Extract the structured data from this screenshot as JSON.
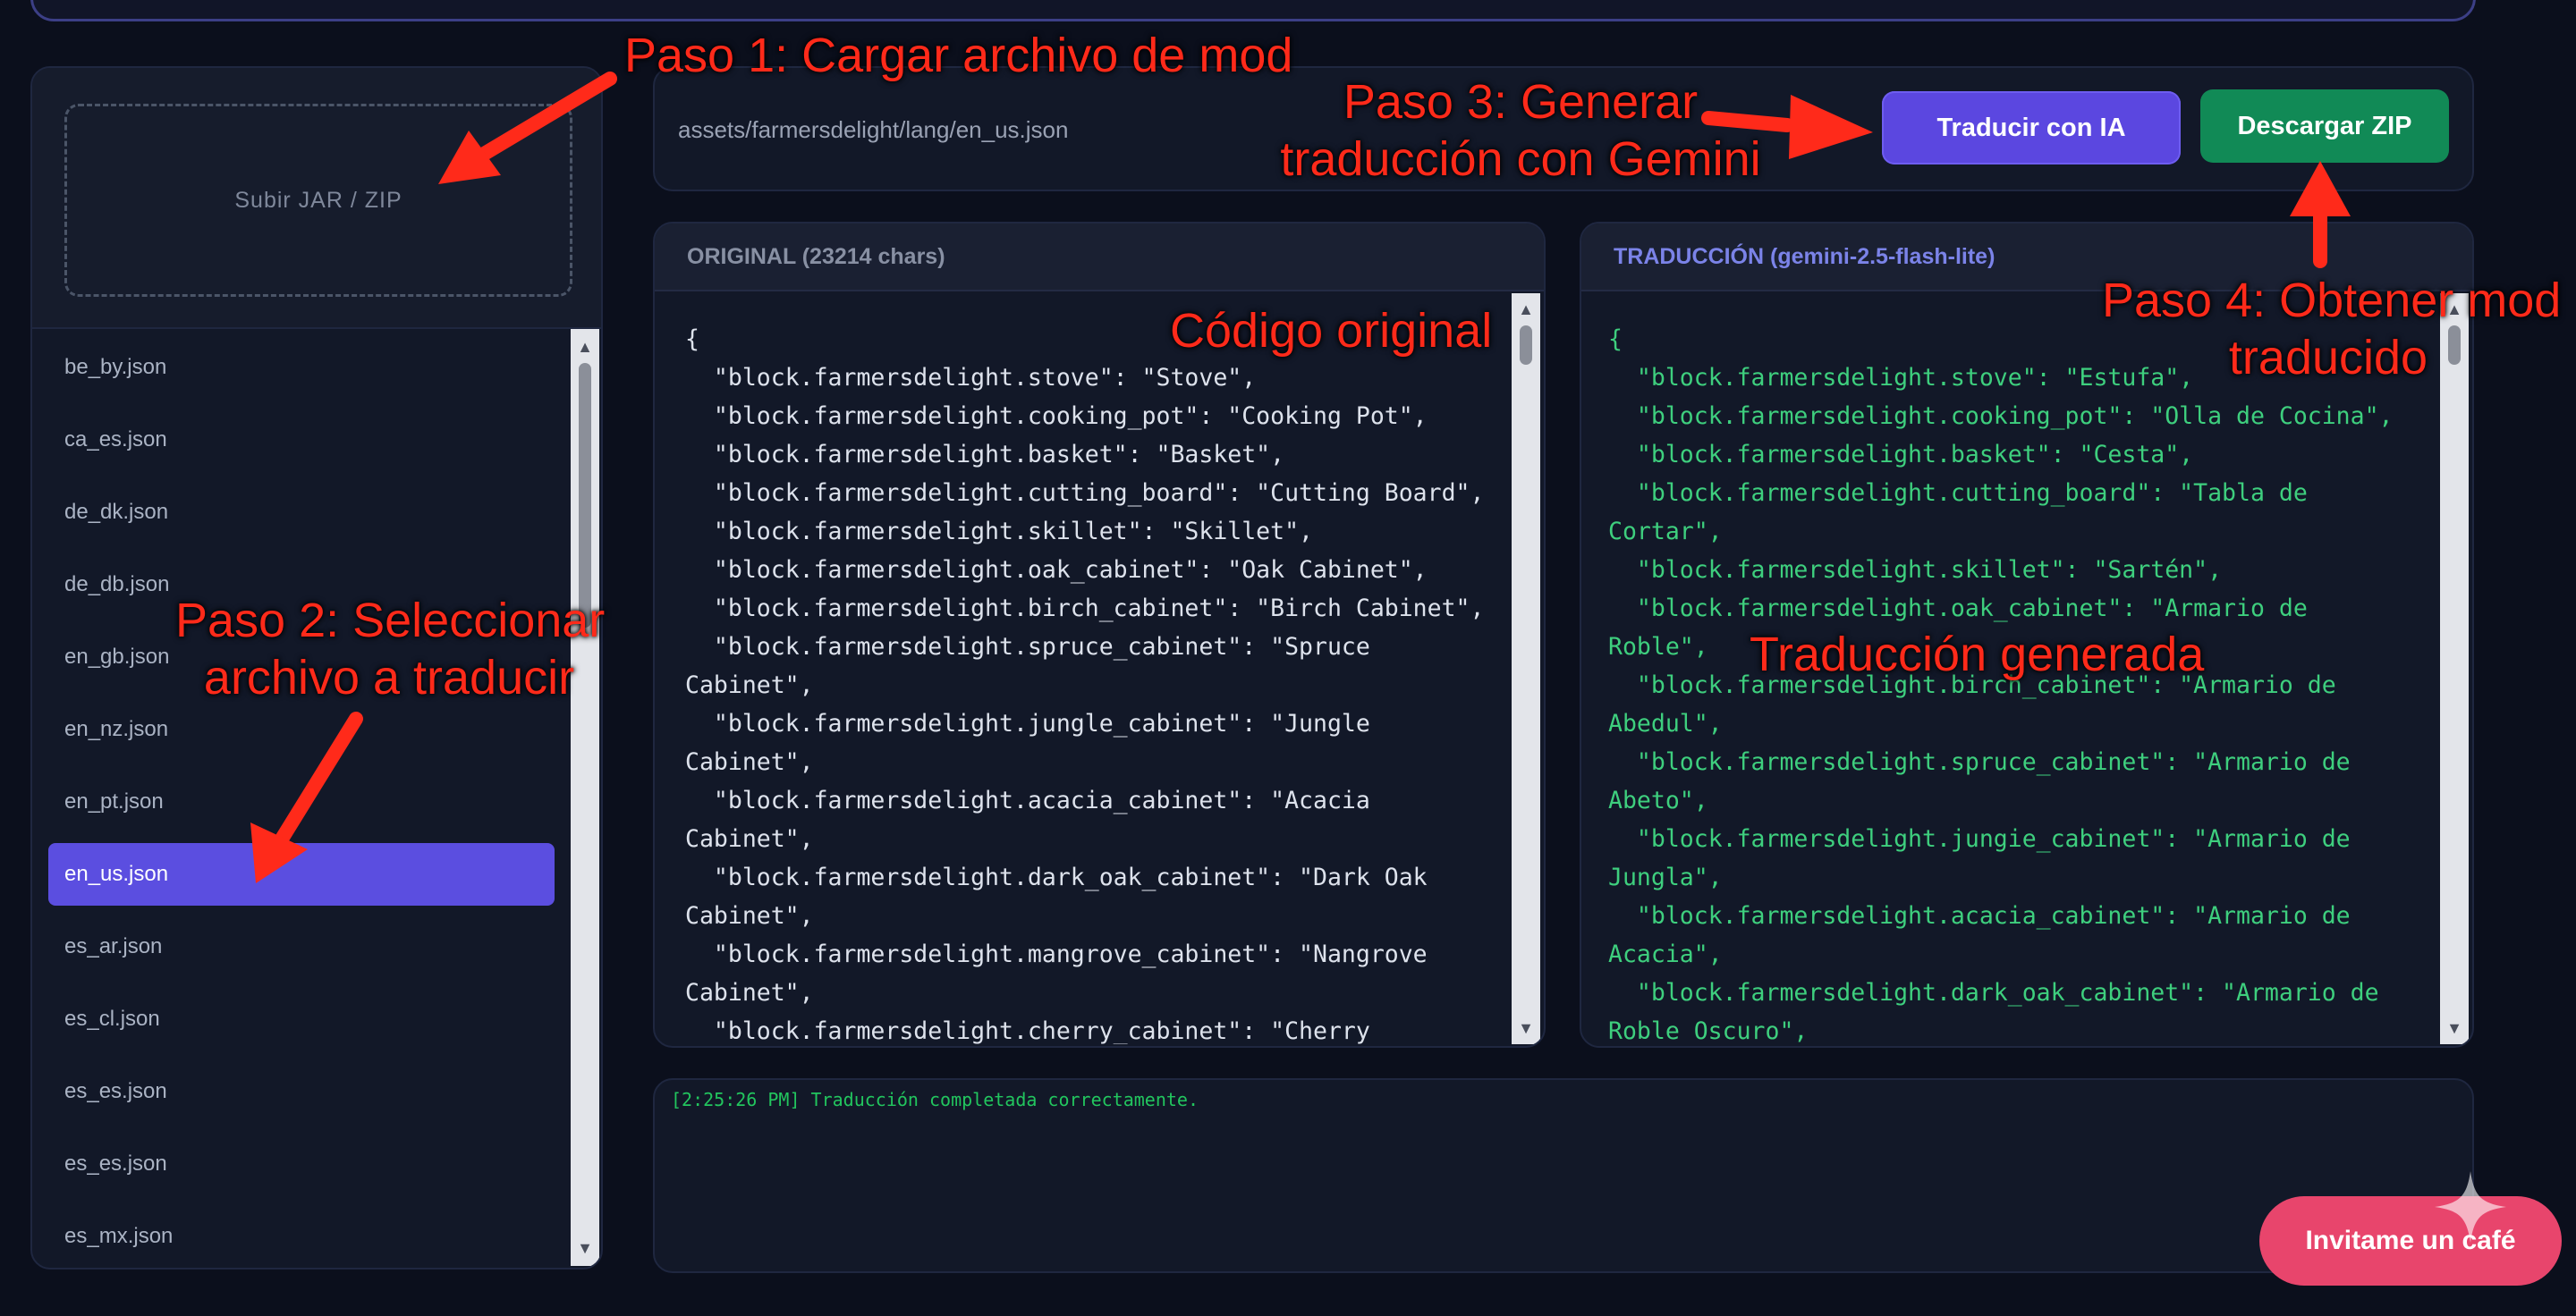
{
  "sidebar": {
    "upload_label": "Subir JAR / ZIP",
    "files": [
      {
        "name": "be_by.json",
        "selected": false
      },
      {
        "name": "ca_es.json",
        "selected": false
      },
      {
        "name": "de_dk.json",
        "selected": false
      },
      {
        "name": "de_db.json",
        "selected": false
      },
      {
        "name": "en_gb.json",
        "selected": false
      },
      {
        "name": "en_nz.json",
        "selected": false
      },
      {
        "name": "en_pt.json",
        "selected": false
      },
      {
        "name": "en_us.json",
        "selected": true
      },
      {
        "name": "es_ar.json",
        "selected": false
      },
      {
        "name": "es_cl.json",
        "selected": false
      },
      {
        "name": "es_es.json",
        "selected": false
      },
      {
        "name": "es_es.json",
        "selected": false
      },
      {
        "name": "es_mx.json",
        "selected": false
      }
    ]
  },
  "toolbar": {
    "path": "assets/farmersdelight/lang/en_us.json",
    "translate_label": "Traducir con IA",
    "download_label": "Descargar ZIP"
  },
  "original": {
    "header": "ORIGINAL (23214 chars)",
    "code": "{\n  \"block.farmersdelight.stove\": \"Stove\",\n  \"block.farmersdelight.cooking_pot\": \"Cooking Pot\",\n  \"block.farmersdelight.basket\": \"Basket\",\n  \"block.farmersdelight.cutting_board\": \"Cutting Board\",\n  \"block.farmersdelight.skillet\": \"Skillet\",\n  \"block.farmersdelight.oak_cabinet\": \"Oak Cabinet\",\n  \"block.farmersdelight.birch_cabinet\": \"Birch Cabinet\",\n  \"block.farmersdelight.spruce_cabinet\": \"Spruce\nCabinet\",\n  \"block.farmersdelight.jungle_cabinet\": \"Jungle\nCabinet\",\n  \"block.farmersdelight.acacia_cabinet\": \"Acacia\nCabinet\",\n  \"block.farmersdelight.dark_oak_cabinet\": \"Dark Oak\nCabinet\",\n  \"block.farmersdelight.mangrove_cabinet\": \"Nangrove\nCabinet\",\n  \"block.farmersdelight.cherry_cabinet\": \"Cherry"
  },
  "translation": {
    "header": "TRADUCCIÓN (gemini-2.5-flash-lite)",
    "code": "{\n  \"block.farmersdelight.stove\": \"Estufa\",\n  \"block.farmersdelight.cooking_pot\": \"Olla de Cocina\",\n  \"block.farmersdelight.basket\": \"Cesta\",\n  \"block.farmersdelight.cutting_board\": \"Tabla de\nCortar\",\n  \"block.farmersdelight.skillet\": \"Sartén\",\n  \"block.farmersdelight.oak_cabinet\": \"Armario de\nRoble\",\n  \"block.farmersdelight.birch_cabinet\": \"Armario de\nAbedul\",\n  \"block.farmersdelight.spruce_cabinet\": \"Armario de\nAbeto\",\n  \"block.farmersdelight.jungie_cabinet\": \"Armario de\nJungla\",\n  \"block.farmersdelight.acacia_cabinet\": \"Armario de\nAcacia\",\n  \"block.farmersdelight.dark_oak_cabinet\": \"Armario de\nRoble Oscuro\","
  },
  "log": {
    "line": "[2:25:26 PM] Traducción completada correctamente."
  },
  "coffee_label": "Invitame un café",
  "annotations": {
    "step1": "Paso 1: Cargar archivo de mod",
    "step2_line1": "Paso 2: Seleccionar",
    "step2_line2": "archivo a traducir",
    "step3_line1": "Paso 3: Generar",
    "step3_line2": "traducción con Gemini",
    "step4_line1": "Paso 4: Obtener mod",
    "step4_line2": "traducido",
    "original_code": "Código original",
    "translation_generated": "Traducción generada"
  },
  "colors": {
    "accent": "#5b4ee0",
    "download": "#118a56",
    "annotation": "#ff2a1a",
    "translated_text": "#3ecf7e",
    "coffee": "#e8456c"
  }
}
